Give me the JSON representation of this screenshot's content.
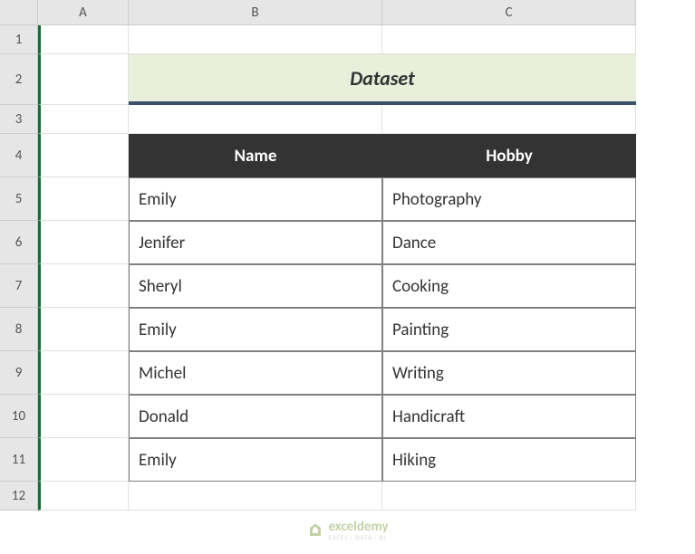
{
  "columns": [
    "A",
    "B",
    "C"
  ],
  "rows": [
    "1",
    "2",
    "3",
    "4",
    "5",
    "6",
    "7",
    "8",
    "9",
    "10",
    "11",
    "12"
  ],
  "title": "Dataset",
  "table": {
    "headers": [
      "Name",
      "Hobby"
    ],
    "data": [
      {
        "name": "Emily",
        "hobby": "Photography"
      },
      {
        "name": "Jenifer",
        "hobby": "Dance"
      },
      {
        "name": "Sheryl",
        "hobby": "Cooking"
      },
      {
        "name": "Emily",
        "hobby": "Painting"
      },
      {
        "name": "Michel",
        "hobby": "Writing"
      },
      {
        "name": "Donald",
        "hobby": "Handicraft"
      },
      {
        "name": "Emily",
        "hobby": "Hiking"
      }
    ]
  },
  "watermark": {
    "brand": "exceldemy",
    "tagline": "EXCEL · DATA · BI"
  }
}
